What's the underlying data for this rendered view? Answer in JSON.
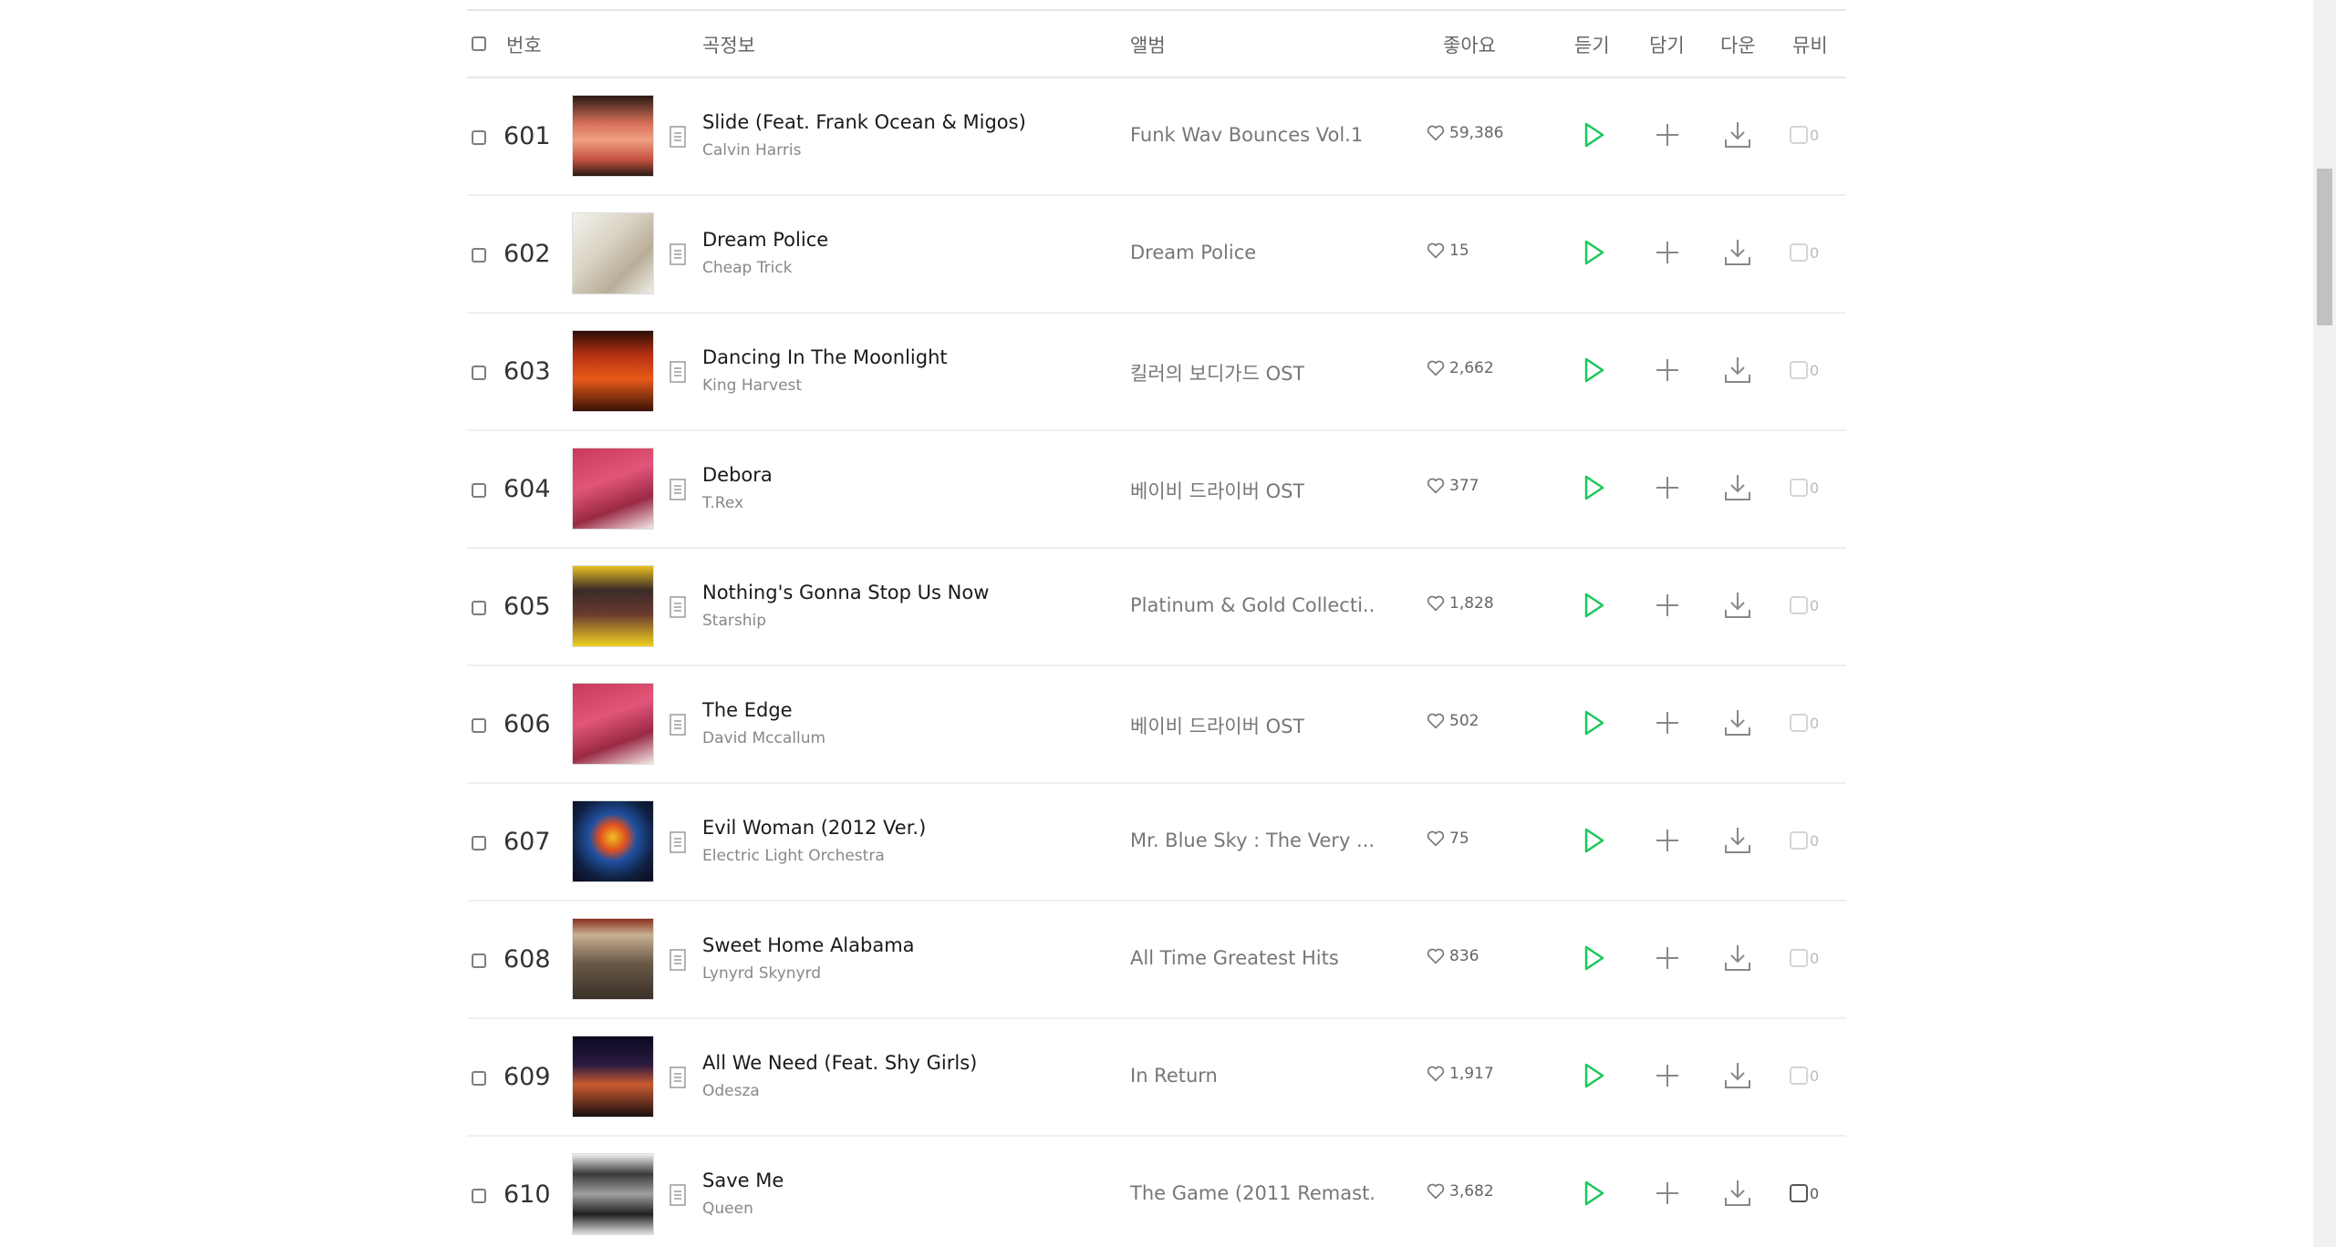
{
  "header": {
    "number": "번호",
    "song_info": "곡정보",
    "album": "앨범",
    "like": "좋아요",
    "listen": "듣기",
    "add": "담기",
    "download": "다운",
    "mv": "뮤비"
  },
  "colors": {
    "play_green": "#19c85a",
    "icon_gray": "#999999",
    "line": "#e6e6e6"
  },
  "songs": [
    {
      "rank": "601",
      "title": "Slide (Feat. Frank Ocean & Migos)",
      "artist": "Calvin Harris",
      "album": "Funk Wav Bounces Vol.1",
      "likes": "59,386",
      "mv": "0"
    },
    {
      "rank": "602",
      "title": "Dream Police",
      "artist": "Cheap Trick",
      "album": "Dream Police",
      "likes": "15",
      "mv": "0"
    },
    {
      "rank": "603",
      "title": "Dancing In The Moonlight",
      "artist": "King Harvest",
      "album": "킬러의 보디가드 OST",
      "likes": "2,662",
      "mv": "0"
    },
    {
      "rank": "604",
      "title": "Debora",
      "artist": "T.Rex",
      "album": "베이비 드라이버 OST",
      "likes": "377",
      "mv": "0"
    },
    {
      "rank": "605",
      "title": "Nothing's Gonna Stop Us Now",
      "artist": "Starship",
      "album": "Platinum & Gold Collecti...",
      "likes": "1,828",
      "mv": "0"
    },
    {
      "rank": "606",
      "title": "The Edge",
      "artist": "David Mccallum",
      "album": "베이비 드라이버 OST",
      "likes": "502",
      "mv": "0"
    },
    {
      "rank": "607",
      "title": "Evil Woman (2012 Ver.)",
      "artist": "Electric Light Orchestra",
      "album": "Mr. Blue Sky : The Very ...",
      "likes": "75",
      "mv": "0"
    },
    {
      "rank": "608",
      "title": "Sweet Home Alabama",
      "artist": "Lynyrd Skynyrd",
      "album": "All Time Greatest Hits",
      "likes": "836",
      "mv": "0"
    },
    {
      "rank": "609",
      "title": "All We Need (Feat. Shy Girls)",
      "artist": "Odesza",
      "album": "In Return",
      "likes": "1,917",
      "mv": "0"
    },
    {
      "rank": "610",
      "title": "Save Me",
      "artist": "Queen",
      "album": "The Game (2011 Remast...",
      "likes": "3,682",
      "mv": "0"
    }
  ]
}
